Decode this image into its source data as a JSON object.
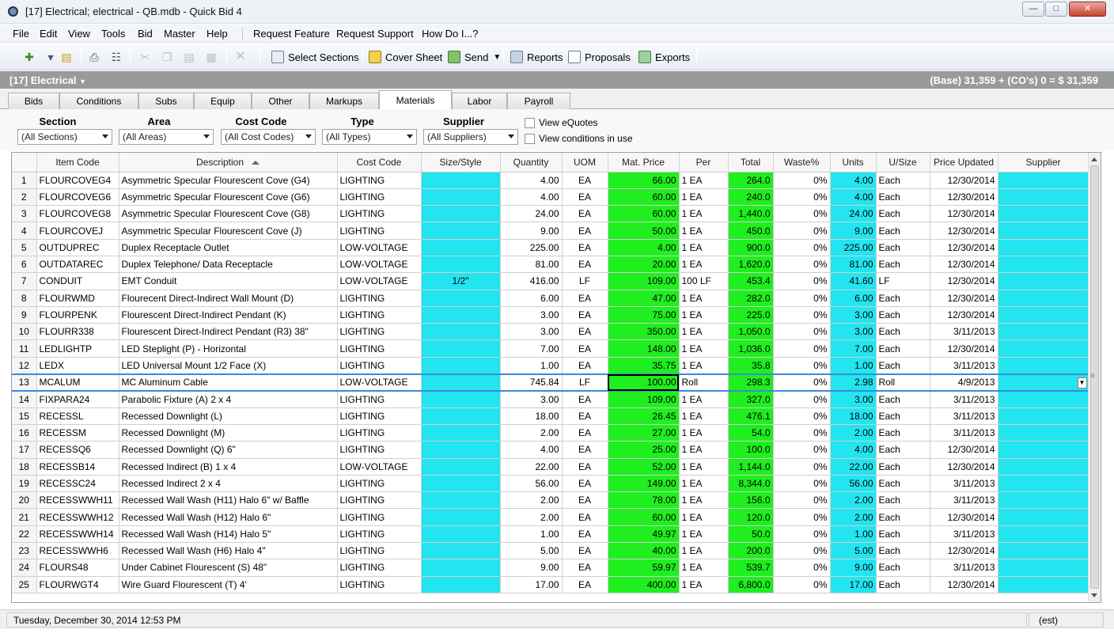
{
  "window": {
    "title": "[17] Electrical; electrical - QB.mdb - Quick Bid 4"
  },
  "menu": {
    "items": [
      "File",
      "Edit",
      "View",
      "Tools",
      "Bid",
      "Master",
      "Help"
    ],
    "extras": [
      "Request Feature",
      "Request Support",
      "How Do I...?"
    ]
  },
  "toolbar": {
    "select_sections": "Select Sections",
    "cover_sheet": "Cover Sheet",
    "send": "Send",
    "reports": "Reports",
    "proposals": "Proposals",
    "exports": "Exports"
  },
  "section": {
    "name": "[17] Electrical",
    "totals": "(Base) 31,359 + (CO's) 0 = $ 31,359"
  },
  "tabs": [
    "Bids",
    "Conditions",
    "Subs",
    "Equip",
    "Other",
    "Markups",
    "Materials",
    "Labor",
    "Payroll"
  ],
  "active_tab": "Materials",
  "filters": {
    "section": {
      "label": "Section",
      "value": "(All Sections)"
    },
    "area": {
      "label": "Area",
      "value": "(All Areas)"
    },
    "cost_code": {
      "label": "Cost Code",
      "value": "(All Cost Codes)"
    },
    "type": {
      "label": "Type",
      "value": "(All Types)"
    },
    "supplier": {
      "label": "Supplier",
      "value": "(All Suppliers)"
    },
    "view_equotes": "View eQuotes",
    "view_conditions": "View conditions in use"
  },
  "grid": {
    "columns": [
      "Item Code",
      "Description",
      "Cost Code",
      "Size/Style",
      "Quantity",
      "UOM",
      "Mat. Price",
      "Per",
      "Total",
      "Waste%",
      "Units",
      "U/Size",
      "Price Updated",
      "Supplier"
    ],
    "rows": [
      [
        "1",
        "FLOURCOVEG4",
        "Asymmetric Specular Flourescent Cove (G4)",
        "LIGHTING",
        "",
        "4.00",
        "EA",
        "66.00",
        "1 EA",
        "264.0",
        "0%",
        "4.00",
        "Each",
        "12/30/2014",
        ""
      ],
      [
        "2",
        "FLOURCOVEG6",
        "Asymmetric Specular Flourescent Cove (G6)",
        "LIGHTING",
        "",
        "4.00",
        "EA",
        "60.00",
        "1 EA",
        "240.0",
        "0%",
        "4.00",
        "Each",
        "12/30/2014",
        ""
      ],
      [
        "3",
        "FLOURCOVEG8",
        "Asymmetric Specular Flourescent Cove (G8)",
        "LIGHTING",
        "",
        "24.00",
        "EA",
        "60.00",
        "1 EA",
        "1,440.0",
        "0%",
        "24.00",
        "Each",
        "12/30/2014",
        ""
      ],
      [
        "4",
        "FLOURCOVEJ",
        "Asymmetric Specular Flourescent Cove (J)",
        "LIGHTING",
        "",
        "9.00",
        "EA",
        "50.00",
        "1 EA",
        "450.0",
        "0%",
        "9.00",
        "Each",
        "12/30/2014",
        ""
      ],
      [
        "5",
        "OUTDUPREC",
        "Duplex Receptacle Outlet",
        "LOW-VOLTAGE",
        "",
        "225.00",
        "EA",
        "4.00",
        "1 EA",
        "900.0",
        "0%",
        "225.00",
        "Each",
        "12/30/2014",
        ""
      ],
      [
        "6",
        "OUTDATAREC",
        "Duplex Telephone/ Data Receptacle",
        "LOW-VOLTAGE",
        "",
        "81.00",
        "EA",
        "20.00",
        "1 EA",
        "1,620.0",
        "0%",
        "81.00",
        "Each",
        "12/30/2014",
        ""
      ],
      [
        "7",
        "CONDUIT",
        "EMT Conduit",
        "LOW-VOLTAGE",
        "1/2\"",
        "416.00",
        "LF",
        "109.00",
        "100 LF",
        "453.4",
        "0%",
        "41.60",
        "LF",
        "12/30/2014",
        ""
      ],
      [
        "8",
        "FLOURWMD",
        "Flourecent Direct-Indirect Wall Mount (D)",
        "LIGHTING",
        "",
        "6.00",
        "EA",
        "47.00",
        "1 EA",
        "282.0",
        "0%",
        "6.00",
        "Each",
        "12/30/2014",
        ""
      ],
      [
        "9",
        "FLOURPENK",
        "Flourescent Direct-Indirect Pendant (K)",
        "LIGHTING",
        "",
        "3.00",
        "EA",
        "75.00",
        "1 EA",
        "225.0",
        "0%",
        "3.00",
        "Each",
        "12/30/2014",
        ""
      ],
      [
        "10",
        "FLOURR338",
        "Flourescent Direct-Indirect Pendant (R3) 38\"",
        "LIGHTING",
        "",
        "3.00",
        "EA",
        "350.00",
        "1 EA",
        "1,050.0",
        "0%",
        "3.00",
        "Each",
        "3/11/2013",
        ""
      ],
      [
        "11",
        "LEDLIGHTP",
        "LED Steplight (P) - Horizontal",
        "LIGHTING",
        "",
        "7.00",
        "EA",
        "148.00",
        "1 EA",
        "1,036.0",
        "0%",
        "7.00",
        "Each",
        "12/30/2014",
        ""
      ],
      [
        "12",
        "LEDX",
        "LED Universal Mount 1/2 Face (X)",
        "LIGHTING",
        "",
        "1.00",
        "EA",
        "35.75",
        "1 EA",
        "35.8",
        "0%",
        "1.00",
        "Each",
        "3/11/2013",
        ""
      ],
      [
        "13",
        "MCALUM",
        "MC Aluminum Cable",
        "LOW-VOLTAGE",
        "",
        "745.84",
        "LF",
        "100.00",
        "Roll",
        "298.3",
        "0%",
        "2.98",
        "Roll",
        "4/9/2013",
        ""
      ],
      [
        "14",
        "FIXPARA24",
        "Parabolic Fixture (A) 2 x 4",
        "LIGHTING",
        "",
        "3.00",
        "EA",
        "109.00",
        "1 EA",
        "327.0",
        "0%",
        "3.00",
        "Each",
        "3/11/2013",
        ""
      ],
      [
        "15",
        "RECESSL",
        "Recessed Downlight (L)",
        "LIGHTING",
        "",
        "18.00",
        "EA",
        "26.45",
        "1 EA",
        "476.1",
        "0%",
        "18.00",
        "Each",
        "3/11/2013",
        ""
      ],
      [
        "16",
        "RECESSM",
        "Recessed Downlight (M)",
        "LIGHTING",
        "",
        "2.00",
        "EA",
        "27.00",
        "1 EA",
        "54.0",
        "0%",
        "2.00",
        "Each",
        "3/11/2013",
        ""
      ],
      [
        "17",
        "RECESSQ6",
        "Recessed Downlight (Q) 6\"",
        "LIGHTING",
        "",
        "4.00",
        "EA",
        "25.00",
        "1 EA",
        "100.0",
        "0%",
        "4.00",
        "Each",
        "12/30/2014",
        ""
      ],
      [
        "18",
        "RECESSB14",
        "Recessed Indirect (B) 1 x 4",
        "LOW-VOLTAGE",
        "",
        "22.00",
        "EA",
        "52.00",
        "1 EA",
        "1,144.0",
        "0%",
        "22.00",
        "Each",
        "12/30/2014",
        ""
      ],
      [
        "19",
        "RECESSC24",
        "Recessed Indirect 2 x 4",
        "LIGHTING",
        "",
        "56.00",
        "EA",
        "149.00",
        "1 EA",
        "8,344.0",
        "0%",
        "56.00",
        "Each",
        "3/11/2013",
        ""
      ],
      [
        "20",
        "RECESSWWH11",
        "Recessed Wall Wash (H11) Halo 6\" w/ Baffle",
        "LIGHTING",
        "",
        "2.00",
        "EA",
        "78.00",
        "1 EA",
        "156.0",
        "0%",
        "2.00",
        "Each",
        "3/11/2013",
        ""
      ],
      [
        "21",
        "RECESSWWH12",
        "Recessed Wall Wash (H12) Halo 6\"",
        "LIGHTING",
        "",
        "2.00",
        "EA",
        "60.00",
        "1 EA",
        "120.0",
        "0%",
        "2.00",
        "Each",
        "12/30/2014",
        ""
      ],
      [
        "22",
        "RECESSWWH14",
        "Recessed Wall Wash (H14) Halo 5\"",
        "LIGHTING",
        "",
        "1.00",
        "EA",
        "49.97",
        "1 EA",
        "50.0",
        "0%",
        "1.00",
        "Each",
        "3/11/2013",
        ""
      ],
      [
        "23",
        "RECESSWWH6",
        "Recessed Wall Wash (H6) Halo 4\"",
        "LIGHTING",
        "",
        "5.00",
        "EA",
        "40.00",
        "1 EA",
        "200.0",
        "0%",
        "5.00",
        "Each",
        "12/30/2014",
        ""
      ],
      [
        "24",
        "FLOURS48",
        "Under Cabinet Flourescent (S) 48\"",
        "LIGHTING",
        "",
        "9.00",
        "EA",
        "59.97",
        "1 EA",
        "539.7",
        "0%",
        "9.00",
        "Each",
        "3/11/2013",
        ""
      ],
      [
        "25",
        "FLOURWGT4",
        "Wire Guard Flourescent (T) 4'",
        "LIGHTING",
        "",
        "17.00",
        "EA",
        "400.00",
        "1 EA",
        "6,800.0",
        "0%",
        "17.00",
        "Each",
        "12/30/2014",
        ""
      ]
    ],
    "selected_row": 13
  },
  "status": {
    "datetime": "Tuesday, December 30, 2014 12:53 PM",
    "mode": "(est)"
  },
  "colors": {
    "cyan": "#22e5f0",
    "green": "#1fee1f",
    "section_bar": "#9a9a9a"
  }
}
